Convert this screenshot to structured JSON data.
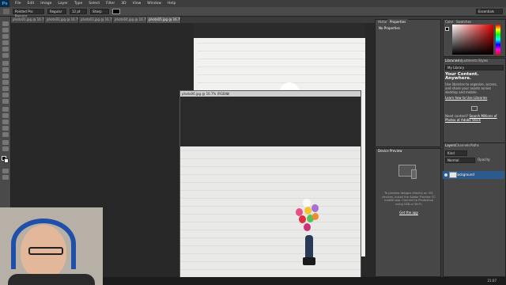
{
  "app": {
    "logo": "Ps"
  },
  "menu": [
    "File",
    "Edit",
    "Image",
    "Layer",
    "Type",
    "Select",
    "Filter",
    "3D",
    "View",
    "Window",
    "Help"
  ],
  "options": {
    "font": "Pointed Pro Regular",
    "style": "Regular",
    "size": "12 pt",
    "aa": "Sharp",
    "workspace": "Essentials"
  },
  "tabs": [
    "photo01.jpg @ 16.7% (RGB/8)",
    "photo02.jpg @ 16.7% (RGB/8)",
    "photo03.jpg @ 16.7% (RGB/8)",
    "photo04.jpg @ 16.7% (RGB/8)",
    "photo05.jpg @ 16.7% (RGB/8)"
  ],
  "floating_doc": {
    "title": "photo06.jpg @ 16.7% (RGB/8)"
  },
  "panels": {
    "history_tab": "History",
    "properties_tab": "Properties",
    "properties_note": "No Properties",
    "color_tab": "Color",
    "swatches_tab": "Swatches",
    "libraries_tab": "Libraries",
    "adjustments_tab": "Adjustments",
    "styles_tab": "Styles",
    "library_select": "My Library",
    "lib_heading": "Your Content. Anywhere.",
    "lib_body": "Use libraries to organize, access, and share your assets across desktop and mobile.",
    "lib_link": "Learn how to Use Libraries",
    "stock_text": "Need content?",
    "stock_link": "Search Millions of Photos at Adobe Stock",
    "device_tab": "Device Preview",
    "device_body": "To preview designs directly on iOS devices, install the Adobe Preview CC mobile app. Connect to Photoshop using USB or Wi-Fi.",
    "device_link": "Get the app",
    "layers_tab": "Layers",
    "channels_tab": "Channels",
    "paths_tab": "Paths",
    "layers_kind": "Kind",
    "layers_mode": "Normal",
    "layers_opacity": "Opacity:",
    "layer_name": "Background"
  },
  "taskbar": {
    "time": "21:07"
  }
}
